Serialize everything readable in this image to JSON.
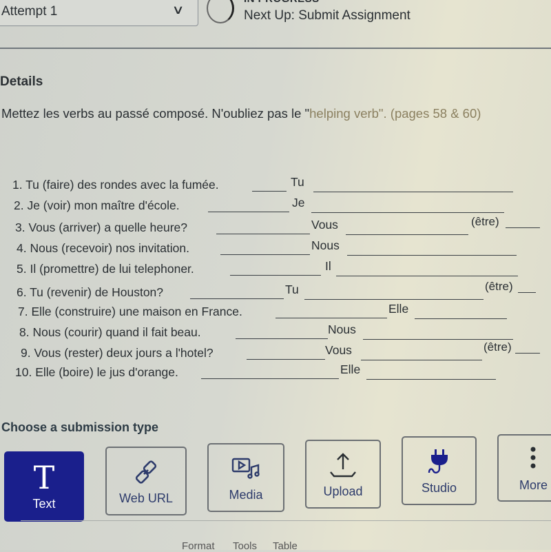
{
  "header": {
    "attempt_label": "Attempt 1",
    "status": "IN PROGRESS",
    "next_up": "Next Up: Submit Assignment"
  },
  "details": {
    "heading": "Details",
    "instructions_main": "Mettez les verbs au passé composé.  N'oubliez pas le \"",
    "instructions_faded": "helping verb\". (pages 58 & 60)"
  },
  "questions": [
    {
      "prompt": "1. Tu (faire) des rondes avec la fumée.",
      "subject": "Tu",
      "aux": ""
    },
    {
      "prompt": "2. Je (voir) mon maître d'école.",
      "subject": "Je",
      "aux": ""
    },
    {
      "prompt": "3. Vous (arriver) a quelle heure?",
      "subject": "Vous",
      "aux": "(être)"
    },
    {
      "prompt": "4. Nous (recevoir) nos invitation.",
      "subject": "Nous",
      "aux": ""
    },
    {
      "prompt": "5. Il (promettre) de lui telephoner.",
      "subject": "Il",
      "aux": ""
    },
    {
      "prompt": "6. Tu (revenir) de Houston?",
      "subject": "Tu",
      "aux": "(être)"
    },
    {
      "prompt": "7. Elle (construire) une maison en France.",
      "subject": "Elle",
      "aux": ""
    },
    {
      "prompt": "8. Nous (courir) quand il fait beau.",
      "subject": "Nous",
      "aux": ""
    },
    {
      "prompt": "9. Vous (rester) deux jours a l'hotel?",
      "subject": "Vous",
      "aux": "(être)"
    },
    {
      "prompt": "10. Elle (boire) le jus d'orange.",
      "subject": "Elle",
      "aux": ""
    }
  ],
  "submission": {
    "heading": "Choose a submission type",
    "types": [
      {
        "label": "Text",
        "icon": "text-icon",
        "selected": true
      },
      {
        "label": "Web URL",
        "icon": "link-icon",
        "selected": false
      },
      {
        "label": "Media",
        "icon": "media-icon",
        "selected": false
      },
      {
        "label": "Upload",
        "icon": "upload-icon",
        "selected": false
      },
      {
        "label": "Studio",
        "icon": "plug-icon",
        "selected": false
      },
      {
        "label": "More",
        "icon": "more-vertical-icon",
        "selected": false
      }
    ]
  },
  "editor_menu": [
    "Format",
    "Tools",
    "Table"
  ],
  "colors": {
    "accent": "#1a1f8c",
    "text": "#2a2f33"
  }
}
